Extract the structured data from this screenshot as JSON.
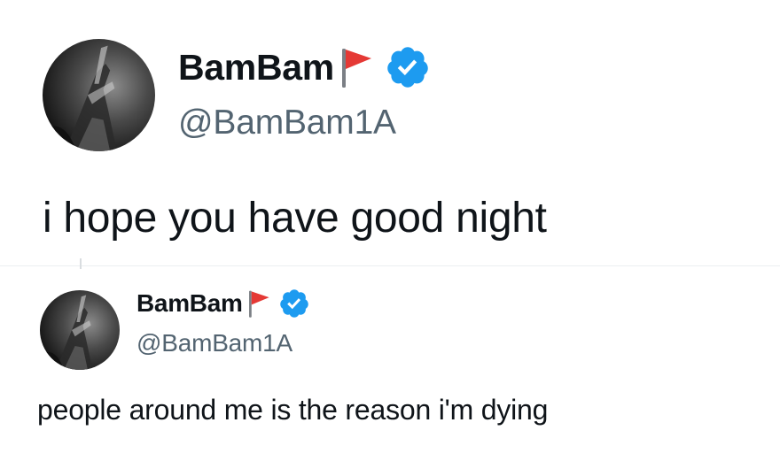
{
  "tweets": [
    {
      "display_name": "BamBam",
      "handle": "@BamBam1A",
      "text": "i hope you have good night",
      "badges": [
        "red-flag-emoji",
        "verified-badge"
      ]
    },
    {
      "display_name": "BamBam",
      "handle": "@BamBam1A",
      "text": "people around me is the reason i'm dying",
      "badges": [
        "red-flag-emoji",
        "verified-badge"
      ]
    }
  ],
  "colors": {
    "text_primary": "#0f1419",
    "text_secondary": "#536471",
    "verified_blue": "#1d9bf0",
    "flag_red": "#e53935",
    "background": "#ffffff"
  }
}
